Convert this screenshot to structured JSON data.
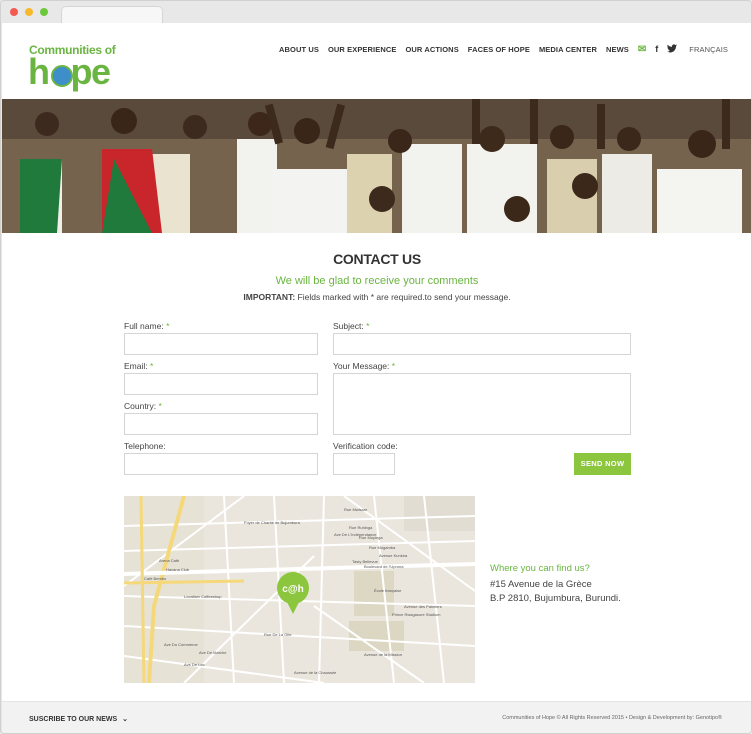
{
  "logo": {
    "top": "Communities of",
    "main": "hope",
    "mark": "®"
  },
  "nav": {
    "items": [
      "ABOUT US",
      "OUR EXPERIENCE",
      "OUR ACTIONS",
      "FACES OF HOPE",
      "MEDIA CENTER",
      "NEWS"
    ],
    "mail_icon": "✉",
    "facebook_icon": "f",
    "twitter_icon": "🐦",
    "language": "FRANÇAIS"
  },
  "contact": {
    "title": "CONTACT US",
    "subtitle": "We will be glad to receive your comments",
    "important_label": "IMPORTANT:",
    "important_text": "Fields marked with * are required.to send your message."
  },
  "form": {
    "full_name": "Full name:",
    "email": "Email:",
    "country": "Country:",
    "telephone": "Telephone:",
    "subject": "Subject:",
    "message": "Your Message:",
    "verification": "Verification code:",
    "required_mark": "*",
    "send": "SEND NOW"
  },
  "map": {
    "labels": [
      "Foyer de Charité de Bujumbura",
      "Havana Club",
      "Café Bembo",
      "Arena Café",
      "Localiser Coffeeshop",
      "École française",
      "Prince Rwagasore Stadium",
      "Tasty Bellevue",
      "Rue Mwisare",
      "Rue Ruhinga",
      "Rue Muyinga",
      "Rue Mugamba",
      "Avenue Kunkira",
      "Boulevard de l'Uprona",
      "Avenue des Palmiers",
      "Avenue de la Chaussée",
      "Avenue de la Mission",
      "Ave Du Commerce",
      "Ave De Lac",
      "Ave De Marche",
      "Rue De La Gite",
      "Ave De L'Indépendance"
    ],
    "pin": "c@h"
  },
  "find_us": {
    "title": "Where you can find us?",
    "line1": "#15 Avenue de la Grèce",
    "line2": "B.P 2810, Bujumbura, Burundi."
  },
  "footer": {
    "subscribe": "SUSCRIBE TO OUR NEWS",
    "chevron": "⌄",
    "copyright": "Communities of Hope © All Rights Reserved 2015 • Design & Development by: Genotipo®"
  },
  "colors": {
    "brand_green": "#6ab541",
    "button_green": "#8cc63f"
  }
}
